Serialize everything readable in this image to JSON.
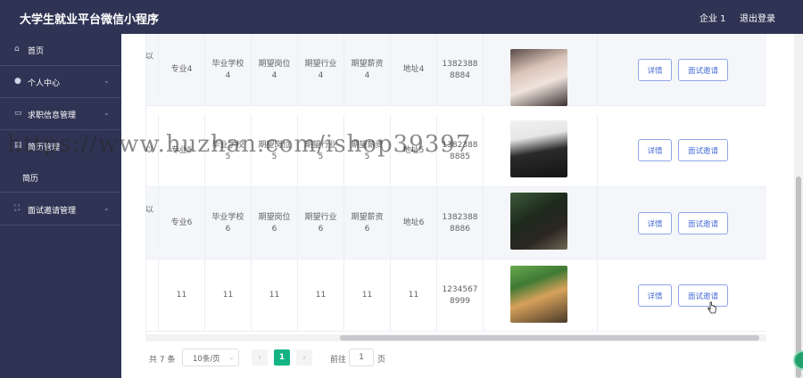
{
  "header": {
    "title": "大学生就业平台微信小程序",
    "user": "企业 1",
    "logout": "退出登录"
  },
  "sidebar": {
    "items": [
      {
        "label": "首页"
      },
      {
        "label": "个人中心"
      },
      {
        "label": "求职信息管理"
      },
      {
        "label": "简历管理"
      },
      {
        "label": "简历"
      },
      {
        "label": "面试邀请管理"
      }
    ]
  },
  "table": {
    "rows": [
      {
        "c0": "以",
        "major": "专业4",
        "school": "毕业学校\n4",
        "post": "期望岗位\n4",
        "industry": "期望行业\n4",
        "salary": "期望薪资\n4",
        "addr": "地址4",
        "phone": "1382388\n8884"
      },
      {
        "c0": "以",
        "major": "专业5",
        "school": "毕业学校\n5",
        "post": "期望岗位\n5",
        "industry": "期望行业\n5",
        "salary": "期望薪资\n5",
        "addr": "地址5",
        "phone": "1382388\n8885"
      },
      {
        "c0": "以",
        "major": "专业6",
        "school": "毕业学校\n6",
        "post": "期望岗位\n6",
        "industry": "期望行业\n6",
        "salary": "期望薪资\n6",
        "addr": "地址6",
        "phone": "1382388\n8886"
      },
      {
        "c0": "",
        "major": "11",
        "school": "11",
        "post": "11",
        "industry": "11",
        "salary": "11",
        "addr": "11",
        "phone": "1234567\n8999"
      }
    ],
    "detail_label": "详情",
    "invite_label": "面试邀请"
  },
  "pagination": {
    "total": "共 7 条",
    "page_size": "10条/页",
    "current_page": "1",
    "goto_label": "前往",
    "goto_value": "1",
    "page_suffix": "页",
    "prev_icon": "‹",
    "next_icon": "›"
  },
  "watermark": "https://www.huzhan.com/ishop39397"
}
